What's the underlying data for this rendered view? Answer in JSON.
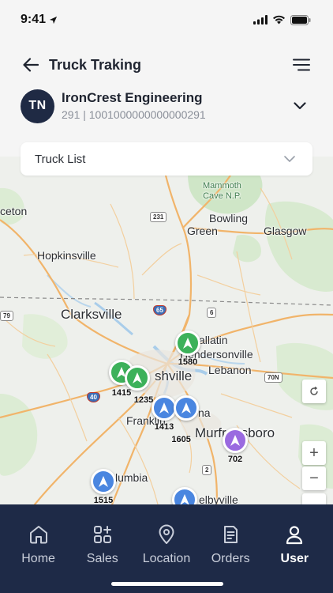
{
  "status_bar": {
    "time": "9:41"
  },
  "header": {
    "title": "Truck Traking"
  },
  "company": {
    "initials": "TN",
    "name": "IronCrest Engineering",
    "subtitle": "291 | 1001000000000000291"
  },
  "truck_list": {
    "label": "Truck List"
  },
  "map": {
    "places": {
      "mammoth": "Mammoth\nCave N.P.",
      "bowling_green": "Bowling\nGreen",
      "glasgow": "Glasgow",
      "hopkinsville": "Hopkinsville",
      "clarksville": "Clarksville",
      "gallatin": "allatin",
      "hendersonville": "Hendersonville",
      "nashville": "shville",
      "lebanon": "Lebanon",
      "franklin": "Franklin",
      "murfreesboro": "Murfreesboro",
      "smyrna": "na",
      "columbia": "lumbia",
      "shelbyville": "elbyville",
      "princeton": "ceton"
    },
    "shields": {
      "s231": "231",
      "s65": "65",
      "s6": "6",
      "s79": "79",
      "s40": "40",
      "s70n": "70N",
      "s2": "2"
    },
    "markers": [
      {
        "id": "1580",
        "label": "1580",
        "color": "#3cb15a"
      },
      {
        "id": "cluster-a",
        "label": "1415",
        "color": "#3cb15a"
      },
      {
        "id": "cluster-b",
        "label": "1235",
        "color": "#3cb15a"
      },
      {
        "id": "1413",
        "label": "1413",
        "color": "#4a86e0"
      },
      {
        "id": "1605",
        "label": "1605",
        "color": "#4a86e0"
      },
      {
        "id": "702",
        "label": "702",
        "color": "#9a6ae0"
      },
      {
        "id": "1515",
        "label": "1515",
        "color": "#4a86e0"
      },
      {
        "id": "bottom",
        "label": "",
        "color": "#4a86e0"
      }
    ],
    "controls": {
      "zoom_in": "+",
      "zoom_out": "−"
    }
  },
  "nav": {
    "items": [
      {
        "label": "Home",
        "icon": "home-icon"
      },
      {
        "label": "Sales",
        "icon": "grid-plus-icon"
      },
      {
        "label": "Location",
        "icon": "location-pin-icon"
      },
      {
        "label": "Orders",
        "icon": "document-icon"
      },
      {
        "label": "User",
        "icon": "user-icon"
      }
    ],
    "active": "User"
  },
  "colors": {
    "nav_bg": "#1e2a47",
    "avatar_bg": "#1f2a44",
    "marker_green": "#3cb15a",
    "marker_blue": "#4a86e0",
    "marker_purple": "#9a6ae0"
  }
}
